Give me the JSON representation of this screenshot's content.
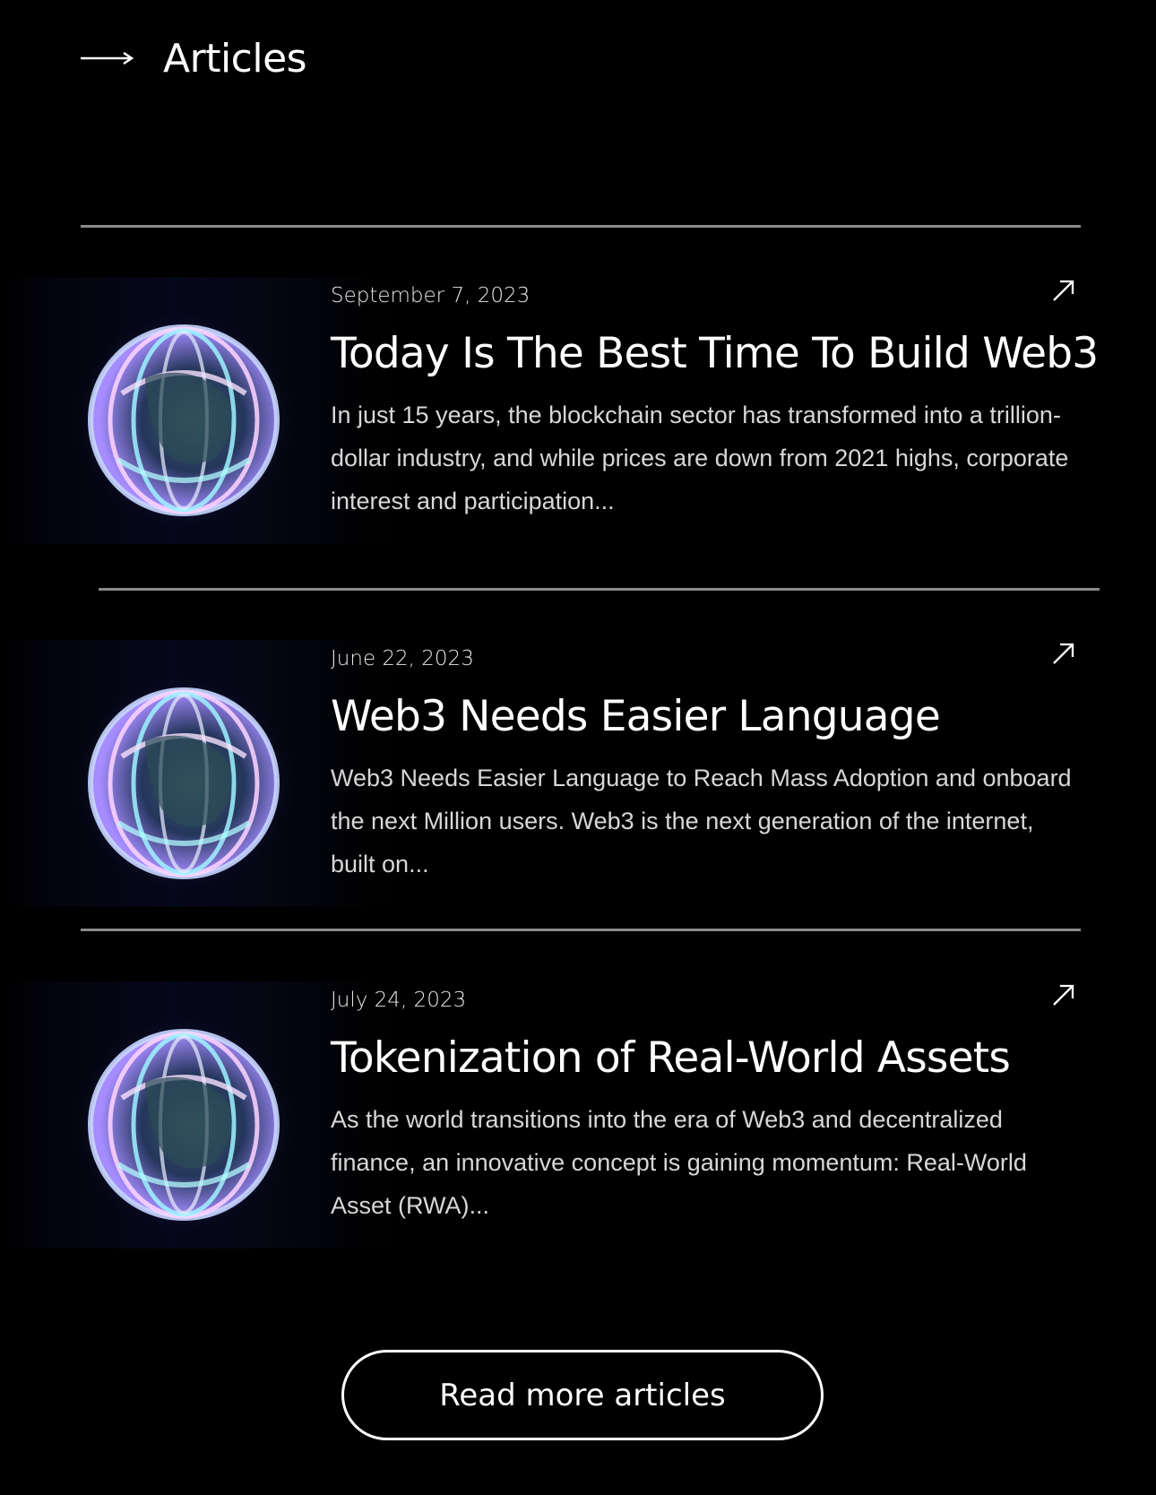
{
  "header": {
    "title": "Articles",
    "icon": "arrow-right-icon"
  },
  "articles": [
    {
      "date": "September 7, 2023",
      "title": "Today Is The Best Time To Build Web3",
      "excerpt": "In just 15 years, the blockchain sector has transformed into a trillion-dollar industry, and while prices are down from 2021 highs, corporate interest and participation...",
      "icon": "arrow-up-right-icon"
    },
    {
      "date": "June 22, 2023",
      "title": "Web3 Needs Easier Language",
      "excerpt": "Web3 Needs Easier Language to Reach Mass Adoption and onboard the next Million users. Web3 is the next generation of the internet, built on...",
      "icon": "arrow-up-right-icon"
    },
    {
      "date": "July 24, 2023",
      "title": "Tokenization of Real-World Assets",
      "excerpt": "As the world transitions into the era of Web3 and decentralized finance, an innovative concept is gaining momentum: Real-World Asset (RWA)...",
      "icon": "arrow-up-right-icon"
    }
  ],
  "cta": {
    "label": "Read more articles"
  },
  "colors": {
    "background": "#000000",
    "text": "#ffffff",
    "muted_text": "#d7d7d7",
    "divider": "#8a8a8a",
    "sphere_glow": "#7c6cff"
  }
}
